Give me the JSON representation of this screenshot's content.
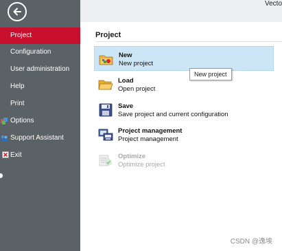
{
  "window": {
    "title": "Vecto"
  },
  "sidebar": {
    "items": [
      {
        "label": "Project",
        "active": true
      },
      {
        "label": "Configuration"
      },
      {
        "label": "User administration"
      },
      {
        "label": "Help"
      },
      {
        "label": "Print"
      },
      {
        "label": "Options",
        "icon": "options-icon"
      },
      {
        "label": "Support Assistant",
        "icon": "support-assistant-icon"
      },
      {
        "label": "Exit",
        "icon": "exit-icon"
      }
    ]
  },
  "main": {
    "section_title": "Project",
    "items": [
      {
        "title": "New",
        "subtitle": "New project",
        "icon": "new-project-icon"
      },
      {
        "title": "Load",
        "subtitle": "Open project",
        "icon": "open-folder-icon"
      },
      {
        "title": "Save",
        "subtitle": "Save project and current configuration",
        "icon": "save-icon"
      },
      {
        "title": "Project management",
        "subtitle": "Project management",
        "icon": "project-management-icon"
      },
      {
        "title": "Optimize",
        "subtitle": "Optimize project",
        "icon": "optimize-icon",
        "disabled": true
      }
    ],
    "tooltip": "New project"
  },
  "watermark": "CSDN @逸埃",
  "colors": {
    "sidebar_bg": "#5b6266",
    "active_bg": "#c8102e",
    "highlight_bg": "#cde6f7"
  }
}
